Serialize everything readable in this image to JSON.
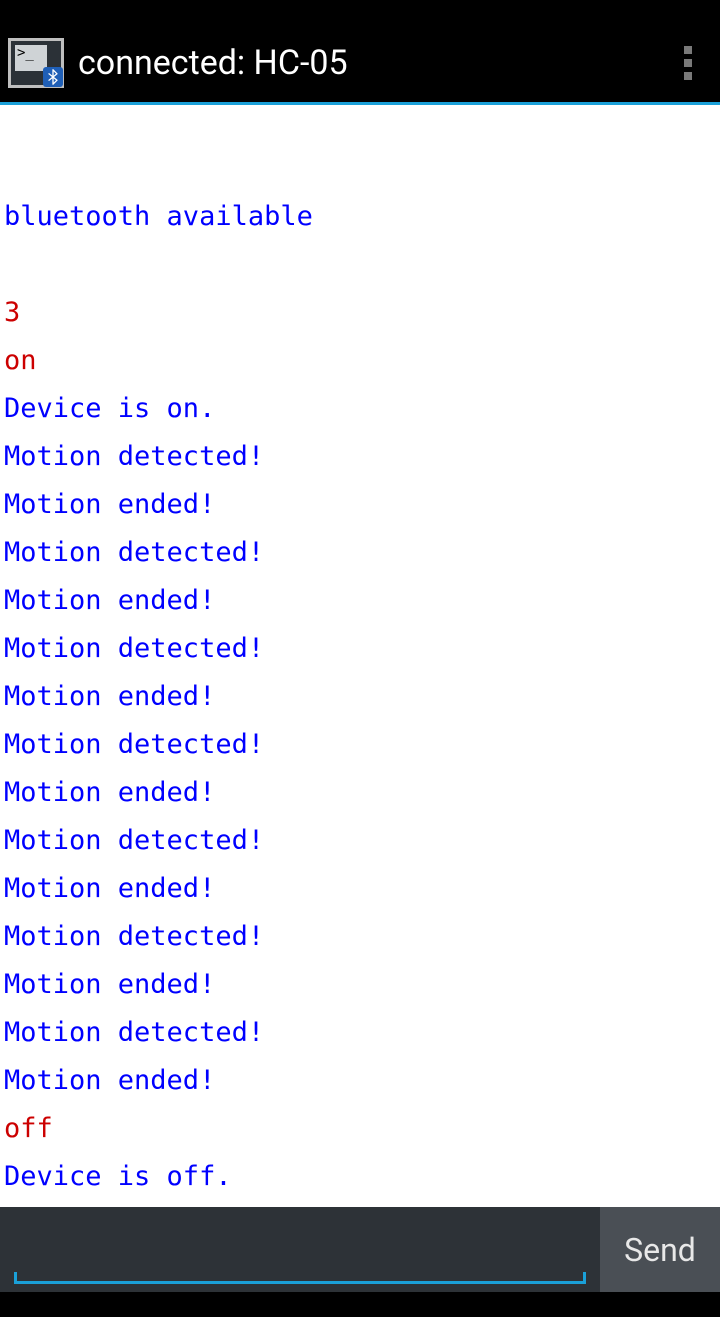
{
  "header": {
    "title": "connected: HC-05",
    "icon_prompt": ">_"
  },
  "terminal": {
    "lines": [
      {
        "text": "",
        "color": "blue"
      },
      {
        "text": "",
        "color": "blue"
      },
      {
        "text": "bluetooth available",
        "color": "blue"
      },
      {
        "text": "",
        "color": "blue"
      },
      {
        "text": "3",
        "color": "red"
      },
      {
        "text": "on",
        "color": "red"
      },
      {
        "text": "Device is on.",
        "color": "blue"
      },
      {
        "text": "Motion detected!",
        "color": "blue"
      },
      {
        "text": "Motion ended!",
        "color": "blue"
      },
      {
        "text": "Motion detected!",
        "color": "blue"
      },
      {
        "text": "Motion ended!",
        "color": "blue"
      },
      {
        "text": "Motion detected!",
        "color": "blue"
      },
      {
        "text": "Motion ended!",
        "color": "blue"
      },
      {
        "text": "Motion detected!",
        "color": "blue"
      },
      {
        "text": "Motion ended!",
        "color": "blue"
      },
      {
        "text": "Motion detected!",
        "color": "blue"
      },
      {
        "text": "Motion ended!",
        "color": "blue"
      },
      {
        "text": "Motion detected!",
        "color": "blue"
      },
      {
        "text": "Motion ended!",
        "color": "blue"
      },
      {
        "text": "Motion detected!",
        "color": "blue"
      },
      {
        "text": "Motion ended!",
        "color": "blue"
      },
      {
        "text": "off",
        "color": "red"
      },
      {
        "text": "Device is off.",
        "color": "blue"
      }
    ]
  },
  "input": {
    "value": "",
    "send_label": "Send"
  },
  "colors": {
    "accent": "#1aa0d8",
    "term_blue": "#0000ff",
    "term_red": "#cc0000"
  }
}
